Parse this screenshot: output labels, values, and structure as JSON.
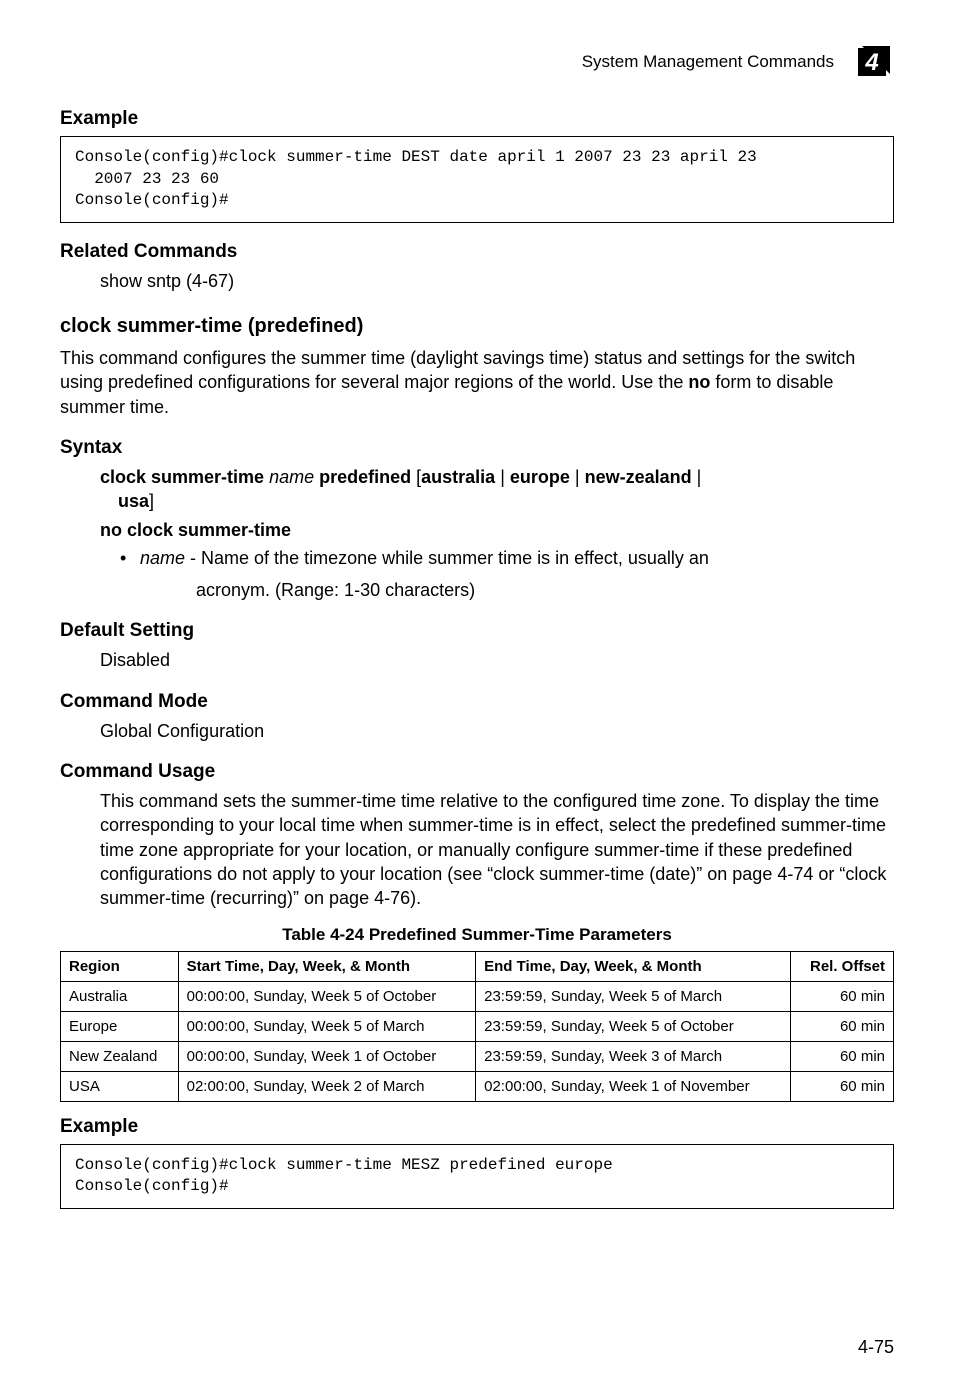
{
  "header": {
    "title": "System Management Commands",
    "chapter": "4"
  },
  "sections": {
    "example1_heading": "Example",
    "example1_code": "Console(config)#clock summer-time DEST date april 1 2007 23 23 april 23\n  2007 23 23 60\nConsole(config)#",
    "related_heading": "Related Commands",
    "related_text": "show sntp (4-67)",
    "command_heading": "clock summer-time (predefined)",
    "command_desc_1": "This command configures the summer time (daylight savings time) status and settings for the switch using predefined configurations for several major regions of the world. Use the ",
    "command_desc_no": "no",
    "command_desc_2": " form to disable summer time.",
    "syntax_heading": "Syntax",
    "syntax_line1_a": "clock summer-time ",
    "syntax_line1_name": "name",
    "syntax_line1_b": " predefined ",
    "syntax_line1_c": "[",
    "syntax_line1_d": "australia",
    "syntax_line1_pipe": " | ",
    "syntax_line1_e": "europe",
    "syntax_line1_f": "new-zealand",
    "syntax_line1_g": " |",
    "syntax_line1_usa": "usa",
    "syntax_line1_end": "]",
    "syntax_line2": "no clock summer-time",
    "bullet_name": "name",
    "bullet_text_a": " - Name of the timezone while summer time is in effect, usually an",
    "bullet_text_b": "acronym. (Range: 1-30 characters)",
    "default_heading": "Default Setting",
    "default_text": "Disabled",
    "mode_heading": "Command Mode",
    "mode_text": "Global Configuration",
    "usage_heading": "Command Usage",
    "usage_text": "This command sets the summer-time time relative to the configured time zone. To display the time corresponding to your local time when summer-time is in effect, select the predefined summer-time time zone appropriate for your location, or manually configure summer-time if these predefined configurations do not apply to your location (see “clock summer-time (date)” on page 4-74 or “clock summer-time (recurring)” on page 4-76).",
    "example2_heading": "Example",
    "example2_code": "Console(config)#clock summer-time MESZ predefined europe\nConsole(config)#"
  },
  "table": {
    "caption": "Table 4-24  Predefined Summer-Time Parameters",
    "headers": {
      "region": "Region",
      "start": "Start Time, Day, Week, & Month",
      "end": "End Time, Day, Week, & Month",
      "offset": "Rel. Offset"
    },
    "rows": [
      {
        "region": "Australia",
        "start": "00:00:00, Sunday, Week 5 of October",
        "end": "23:59:59, Sunday, Week 5 of March",
        "offset": "60 min"
      },
      {
        "region": "Europe",
        "start": "00:00:00, Sunday, Week 5 of March",
        "end": "23:59:59, Sunday, Week 5 of October",
        "offset": "60 min"
      },
      {
        "region": "New Zealand",
        "start": "00:00:00, Sunday, Week 1 of October",
        "end": "23:59:59, Sunday, Week 3 of March",
        "offset": "60 min"
      },
      {
        "region": "USA",
        "start": "02:00:00, Sunday, Week 2 of March",
        "end": "02:00:00, Sunday, Week 1 of November",
        "offset": "60 min"
      }
    ]
  },
  "footer": {
    "page": "4-75"
  }
}
